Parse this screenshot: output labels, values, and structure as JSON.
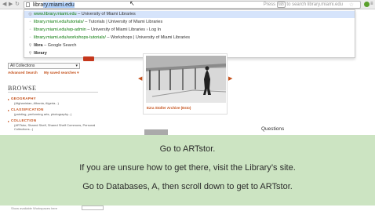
{
  "browser": {
    "url": "library.miami.edu",
    "hint_prefix": "Press",
    "hint_key": "tab",
    "hint_suffix": "to search library.miami.edu"
  },
  "autocomplete": [
    {
      "icon": "globe-icon",
      "url": "www.library.miami.edu",
      "title": "University of Miami Libraries",
      "active": true
    },
    {
      "icon": "page-icon",
      "url": "library.miami.edu/tutorials/",
      "title": "Tutorials | University of Miami Libraries",
      "active": false
    },
    {
      "icon": "page-icon",
      "url": "library.miami.edu/wp-admin",
      "title": "University of Miami Libraries › Log In",
      "active": false
    },
    {
      "icon": "page-icon",
      "url": "library.miami.edu/workshops-tutorials/",
      "title": "Workshops | University of Miami Libraries",
      "active": false
    },
    {
      "icon": "search-icon",
      "url": "libra",
      "title": "Google Search",
      "active": false
    },
    {
      "icon": "search-icon",
      "url": "library",
      "title": "",
      "active": false
    }
  ],
  "site": {
    "collections_select": "All Collections",
    "advanced_search": "Advanced Search",
    "saved_searches": "My saved searches ▾",
    "browse_heading": "BROWSE",
    "categories": [
      {
        "title": "GEOGRAPHY",
        "desc": "(Afghanistan, Albania, Algeria...)"
      },
      {
        "title": "CLASSIFICATION",
        "desc": "(painting, performing arts, photography...)"
      },
      {
        "title": "COLLECTION",
        "desc": "(ARTstor, Shared Shelf, Shared Shelf Commons, Personal"
      },
      {
        "title": "",
        "desc": "Collections...)"
      }
    ],
    "image_caption": "Ezra Stoller Archive (Esto)",
    "questions": "Questions",
    "bottom_text": "Show available Workspaces here"
  },
  "overlay": {
    "line1": "Go to ARTstor.",
    "line2": "If you are unsure how to get there, visit the Library’s site.",
    "line3": "Go to Databases, A, then scroll down to get to ARTstor."
  },
  "colors": {
    "accent": "#c4501a",
    "overlay": "#cce4c2",
    "url_green": "#0b7a0b"
  }
}
